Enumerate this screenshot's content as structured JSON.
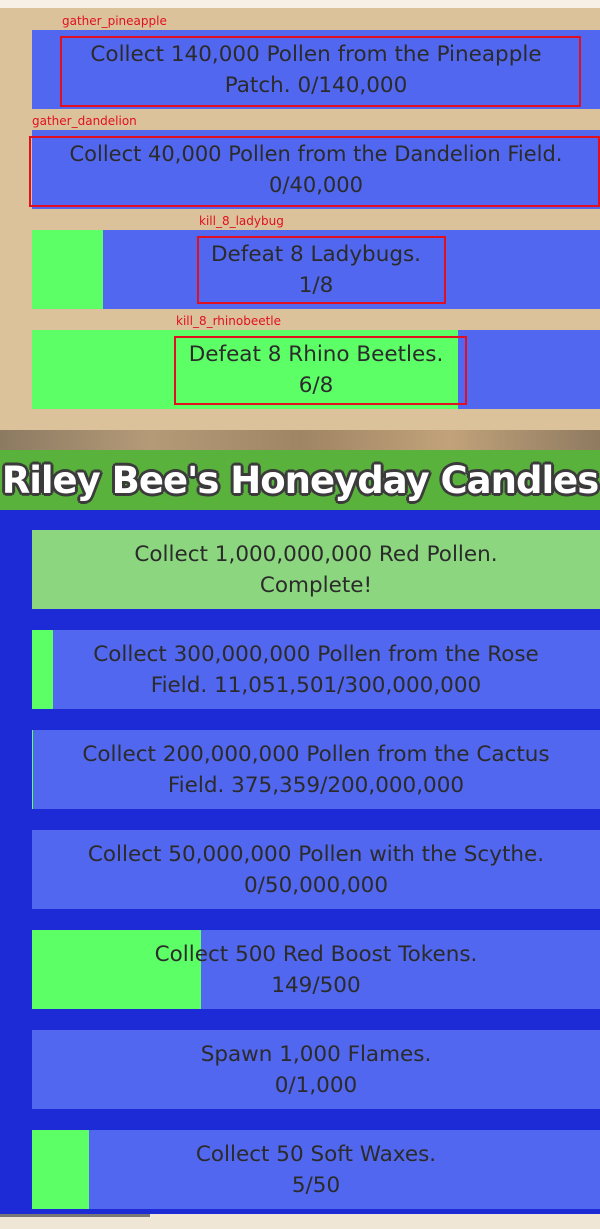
{
  "upper_quests": [
    {
      "line1": "Collect 140,000 Pollen from the Pineapple",
      "line2": "Patch. 0/140,000",
      "progress": 0,
      "annotation": "gather_pineapple"
    },
    {
      "line1": "Collect 40,000 Pollen from the Dandelion Field.",
      "line2": "0/40,000",
      "progress": 0,
      "annotation": "gather_dandelion"
    },
    {
      "line1": "Defeat 8 Ladybugs.",
      "line2": "1/8",
      "progress": 0.125,
      "annotation": "kill_8_ladybug"
    },
    {
      "line1": "Defeat 8 Rhino Beetles.",
      "line2": "6/8",
      "progress": 0.75,
      "annotation": "kill_8_rhinobeetle"
    }
  ],
  "section": {
    "title": "Riley Bee's Honeyday Candles"
  },
  "quests": [
    {
      "line1": "Collect 1,000,000,000 Red Pollen.",
      "line2": "Complete!",
      "progress": 1,
      "complete": true
    },
    {
      "line1": "Collect 300,000,000 Pollen from the Rose",
      "line2": "Field. 11,051,501/300,000,000",
      "progress": 0.0368
    },
    {
      "line1": "Collect 200,000,000 Pollen from the Cactus",
      "line2": "Field. 375,359/200,000,000",
      "progress": 0.0019
    },
    {
      "line1": "Collect 50,000,000 Pollen with the Scythe.",
      "line2": "0/50,000,000",
      "progress": 0
    },
    {
      "line1": "Collect 500 Red Boost Tokens.",
      "line2": "149/500",
      "progress": 0.298
    },
    {
      "line1": "Spawn 1,000 Flames.",
      "line2": "0/1,000",
      "progress": 0
    },
    {
      "line1": "Collect 50 Soft Waxes.",
      "line2": "5/50",
      "progress": 0.1
    }
  ],
  "colors": {
    "bar_background": "#5167ef",
    "progress_fill": "#5dff66",
    "complete_fill": "#8bd67e",
    "header_green": "#58b23c",
    "panel_blue": "#1c2bd6",
    "annotation_red": "#e01020"
  }
}
